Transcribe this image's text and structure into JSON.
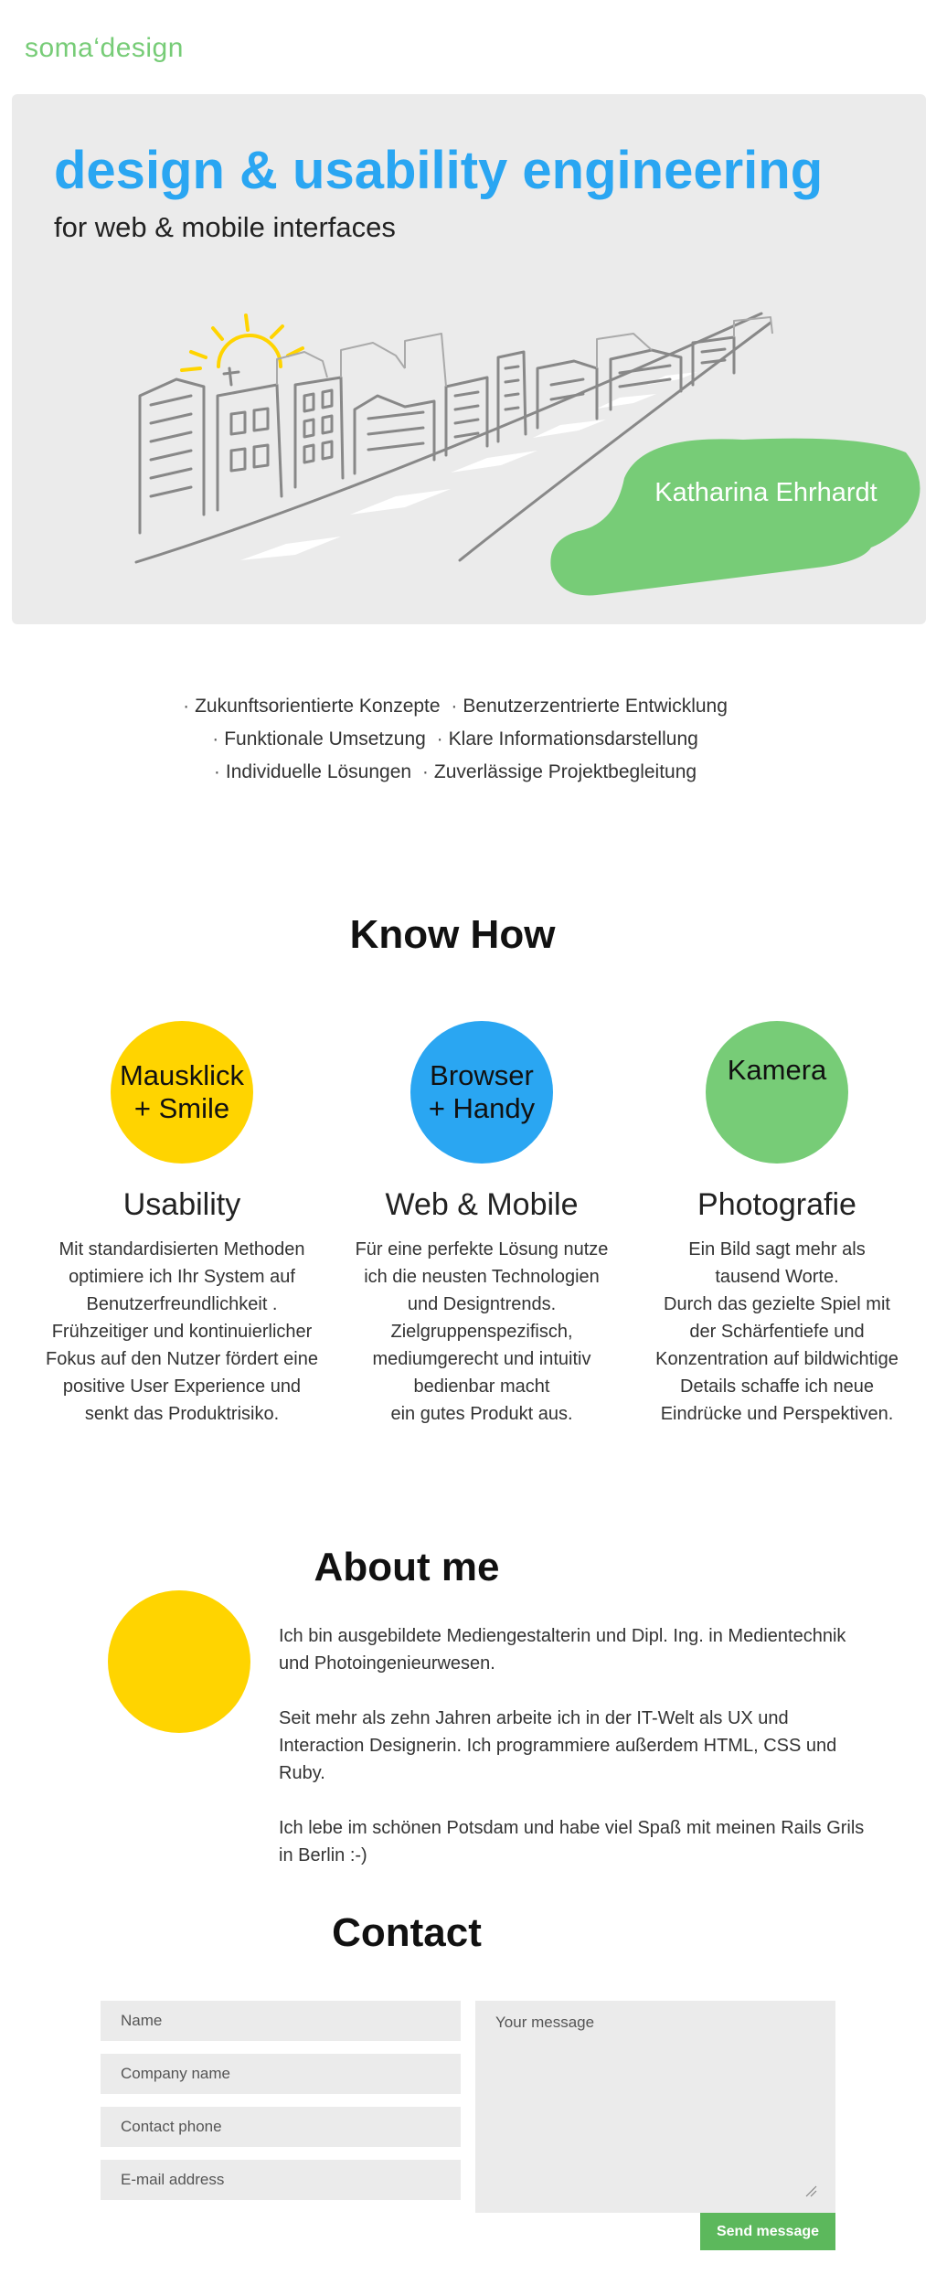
{
  "header": {
    "logo": "soma‘design"
  },
  "hero": {
    "title": "design & usability engineering",
    "subtitle": "for web & mobile interfaces",
    "name": "Katharina Ehrhardt",
    "illustration_icon": "city-sketch-illustration",
    "sun_icon": "sun-icon",
    "colors": {
      "title": "#2aa6f2",
      "badge": "#77cc77",
      "sun": "#ffd400"
    }
  },
  "features": {
    "separator": "·",
    "lines": [
      [
        "Zukunftsorientierte Konzepte",
        "Benutzerzentrierte Entwicklung"
      ],
      [
        "Funktionale Umsetzung",
        "Klare Informationsdarstellung"
      ],
      [
        "Individuelle Lösungen",
        "Zuverlässige Projektbegleitung"
      ]
    ]
  },
  "know_how": {
    "title": "Know How",
    "items": [
      {
        "circle_label": "Mausklick\n+ Smile",
        "heading": "Usability",
        "text": "Mit standardisierten Methoden\noptimiere ich Ihr System auf\nBenutzerfreundlichkeit .\nFrühzeitiger und kontinuierlicher\nFokus auf den Nutzer fördert eine\npositive User Experience und\nsenkt das Produktrisiko.",
        "color": "#ffd400"
      },
      {
        "circle_label": "Browser\n+ Handy",
        "heading": "Web & Mobile",
        "text": "Für eine perfekte Lösung nutze\nich die neusten Technologien\nund Designtrends.\nZielgruppenspezifisch,\nmediumgerecht und intuitiv\nbedienbar macht\nein gutes Produkt aus.",
        "color": "#2aa6f2"
      },
      {
        "circle_label": "Kamera",
        "heading": "Photografie",
        "text": "Ein Bild sagt mehr als\ntausend Worte.\nDurch das gezielte Spiel mit\nder Schärfentiefe und\nKonzentration auf bildwichtige\nDetails schaffe ich neue\nEindrücke und Perspektiven.",
        "color": "#77cc77"
      }
    ]
  },
  "about": {
    "title": "About me",
    "paragraphs": [
      "Ich bin ausgebildete Mediengestalterin und Dipl. Ing. in Medientechnik und Photoingenieurwesen.",
      "Seit mehr als zehn Jahren arbeite ich in der IT-Welt als UX und Interaction Designerin. Ich programmiere außerdem HTML, CSS und Ruby.",
      "Ich lebe im schönen Potsdam und habe viel Spaß mit meinen Rails Grils in Berlin :-)"
    ],
    "color": "#ffd400"
  },
  "contact": {
    "title": "Contact",
    "name_placeholder": "Name",
    "company_placeholder": "Company name",
    "phone_placeholder": "Contact phone",
    "email_placeholder": "E-mail address",
    "message_placeholder": "Your message",
    "send_label": "Send message",
    "button_color": "#5cb85c"
  }
}
